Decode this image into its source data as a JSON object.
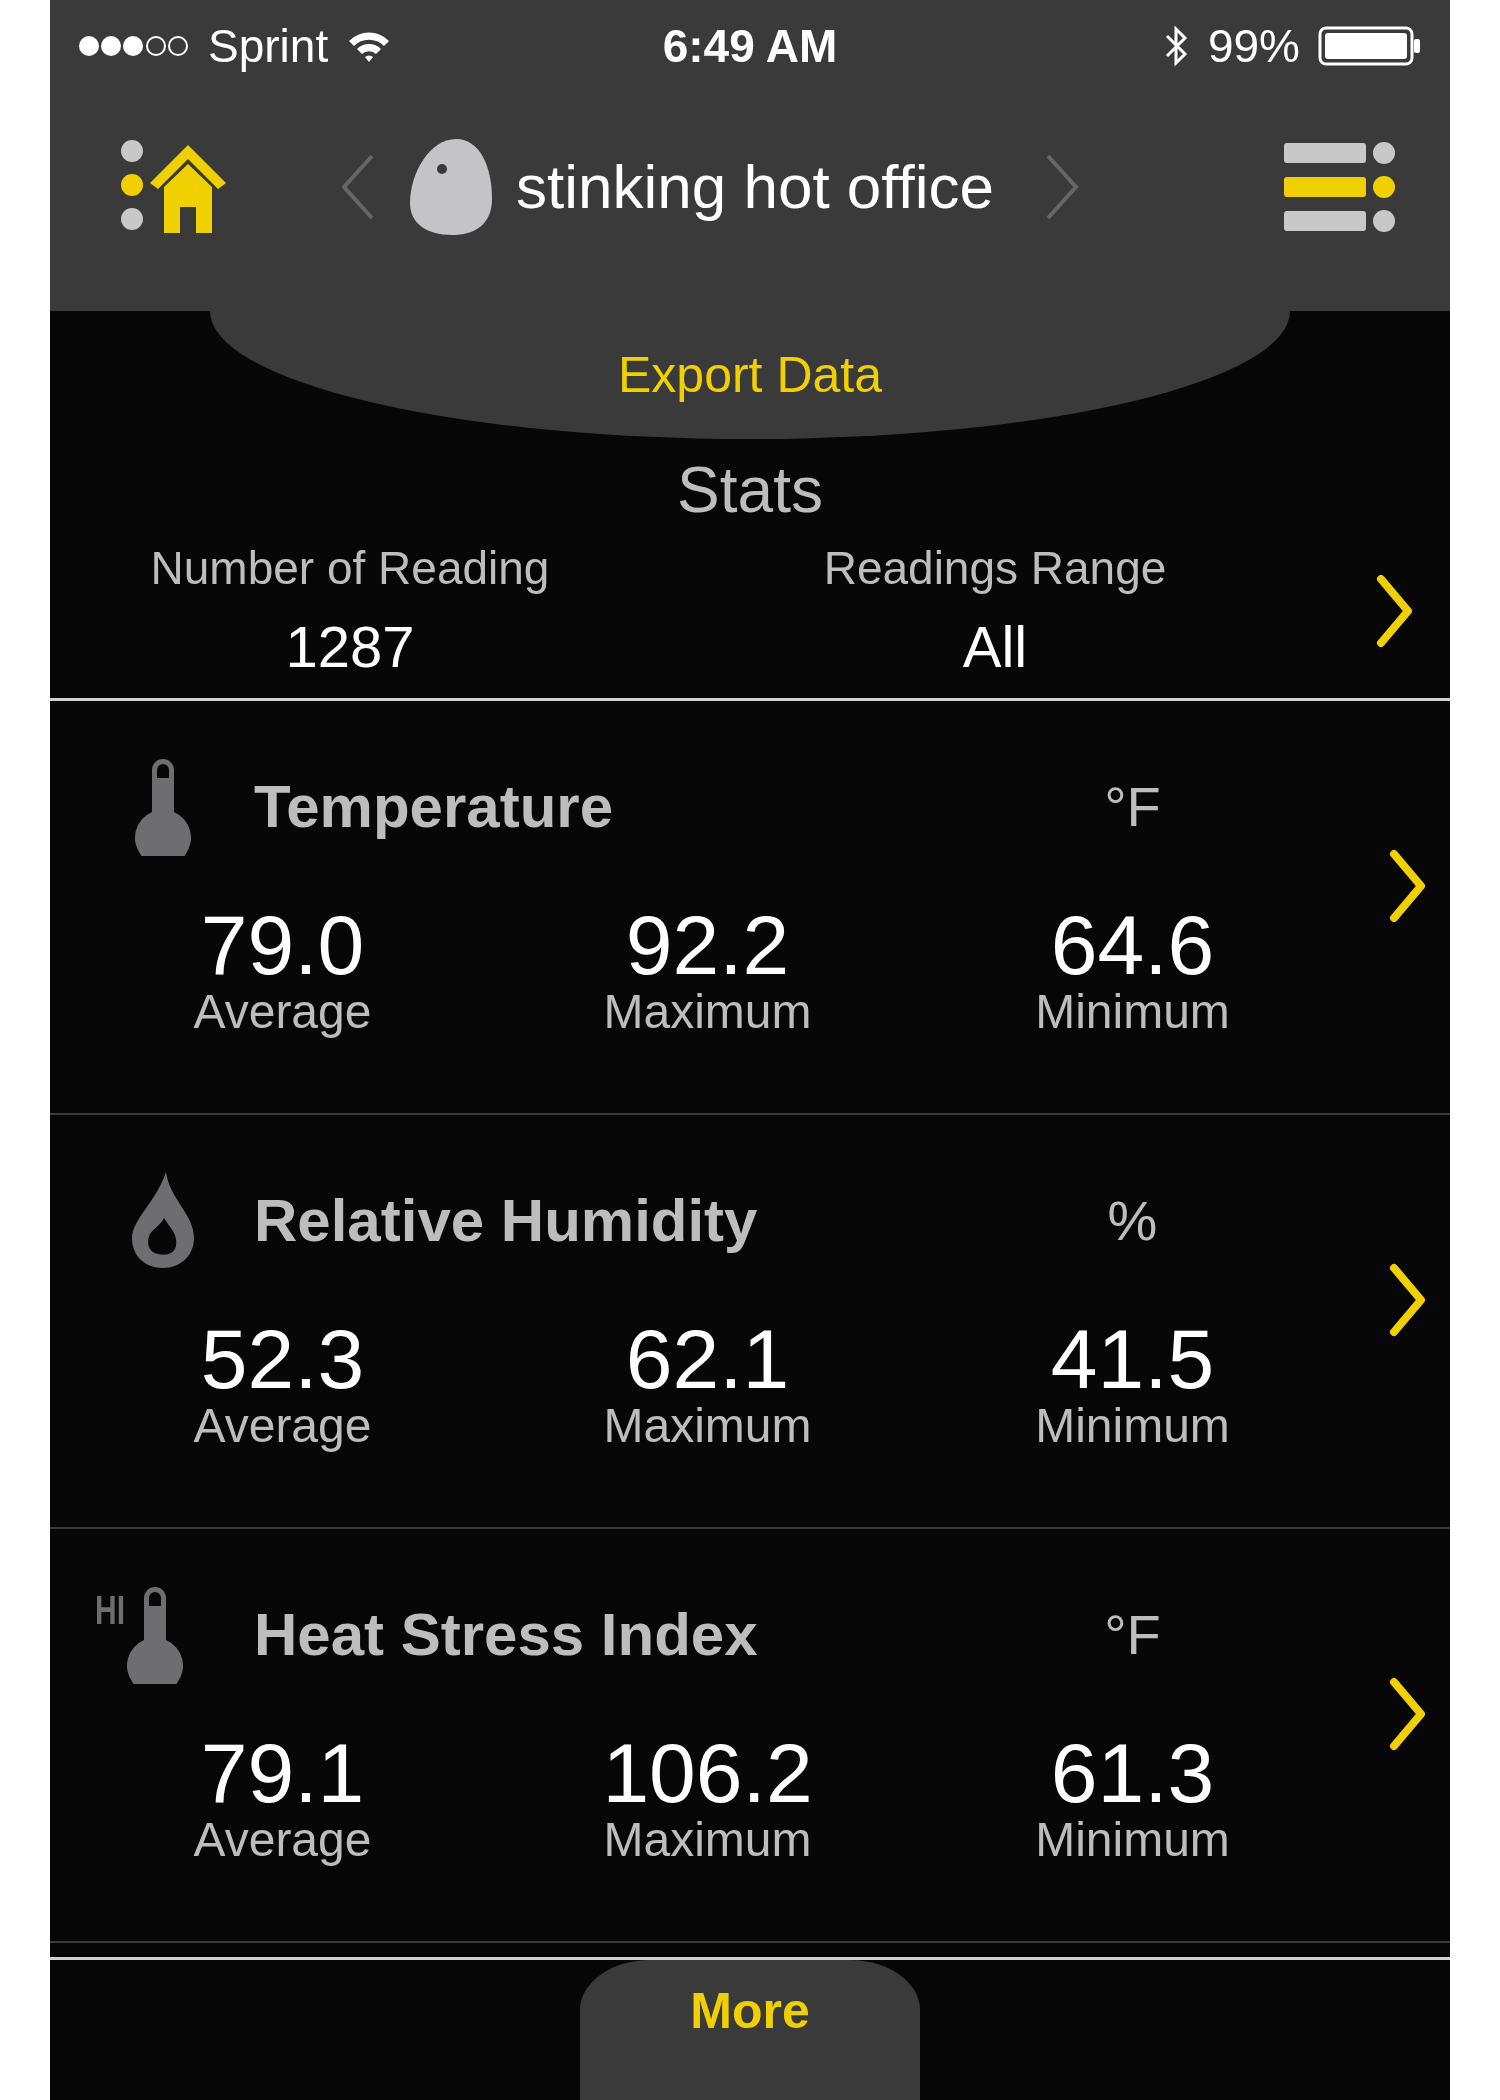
{
  "status_bar": {
    "carrier": "Sprint",
    "time": "6:49 AM",
    "battery": "99%"
  },
  "nav": {
    "title": "stinking hot office"
  },
  "export_tab": {
    "label": "Export Data"
  },
  "stats": {
    "title": "Stats",
    "items": [
      {
        "label": "Number of Reading",
        "value": "1287"
      },
      {
        "label": "Readings Range",
        "value": "All"
      }
    ]
  },
  "sections": [
    {
      "kind": "temperature",
      "title": "Temperature",
      "unit": "°F",
      "values": [
        {
          "value": "79.0",
          "label": "Average"
        },
        {
          "value": "92.2",
          "label": "Maximum"
        },
        {
          "value": "64.6",
          "label": "Minimum"
        }
      ]
    },
    {
      "kind": "humidity",
      "title": "Relative Humidity",
      "unit": "%",
      "values": [
        {
          "value": "52.3",
          "label": "Average"
        },
        {
          "value": "62.1",
          "label": "Maximum"
        },
        {
          "value": "41.5",
          "label": "Minimum"
        }
      ]
    },
    {
      "kind": "heat_index",
      "title": "Heat Stress Index",
      "unit": "°F",
      "icon_label": "HI",
      "values": [
        {
          "value": "79.1",
          "label": "Average"
        },
        {
          "value": "106.2",
          "label": "Maximum"
        },
        {
          "value": "61.3",
          "label": "Minimum"
        }
      ]
    }
  ],
  "more_tab": {
    "label": "More"
  }
}
